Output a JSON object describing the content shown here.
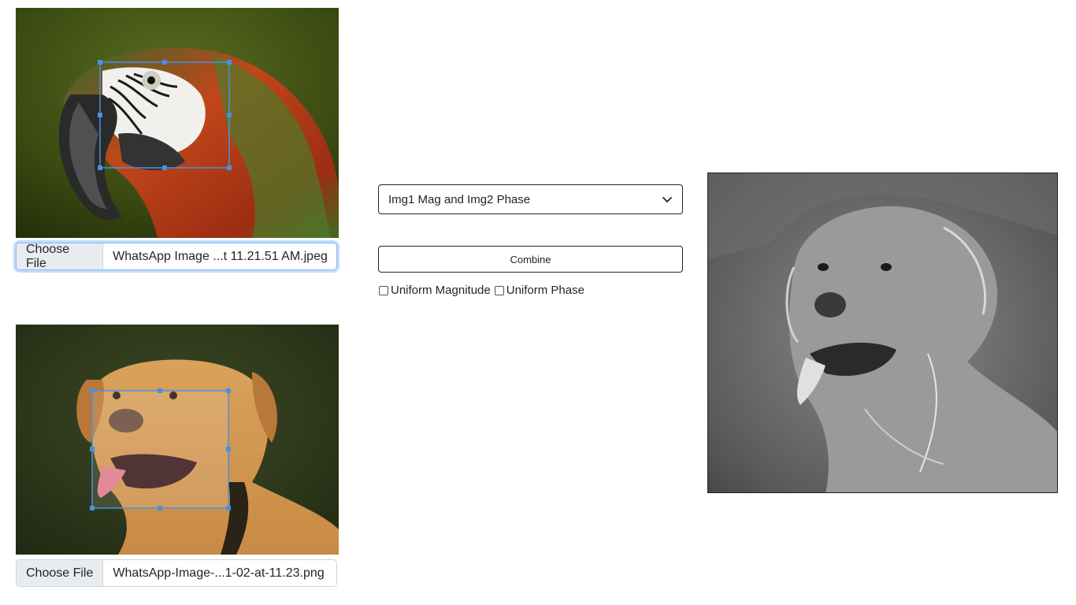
{
  "image1": {
    "alt": "parrot",
    "file_button": "Choose File",
    "file_name": "WhatsApp Image ...t 11.21.51 AM.jpeg"
  },
  "image2": {
    "alt": "dog",
    "file_button": "Choose File",
    "file_name": "WhatsApp-Image-...1-02-at-11.23.png"
  },
  "controls": {
    "mode_selected": "Img1 Mag and Img2 Phase",
    "combine_label": "Combine",
    "uniform_magnitude_label": "Uniform Magnitude",
    "uniform_phase_label": "Uniform Phase",
    "uniform_magnitude_checked": false,
    "uniform_phase_checked": false
  },
  "colors": {
    "selection_box": "#4a90e2",
    "focus_ring": "#86b7fe",
    "input_border": "#ced4da",
    "button_bg": "#e9ecef"
  },
  "icons": {
    "select_arrow": "chevron-down-icon"
  }
}
